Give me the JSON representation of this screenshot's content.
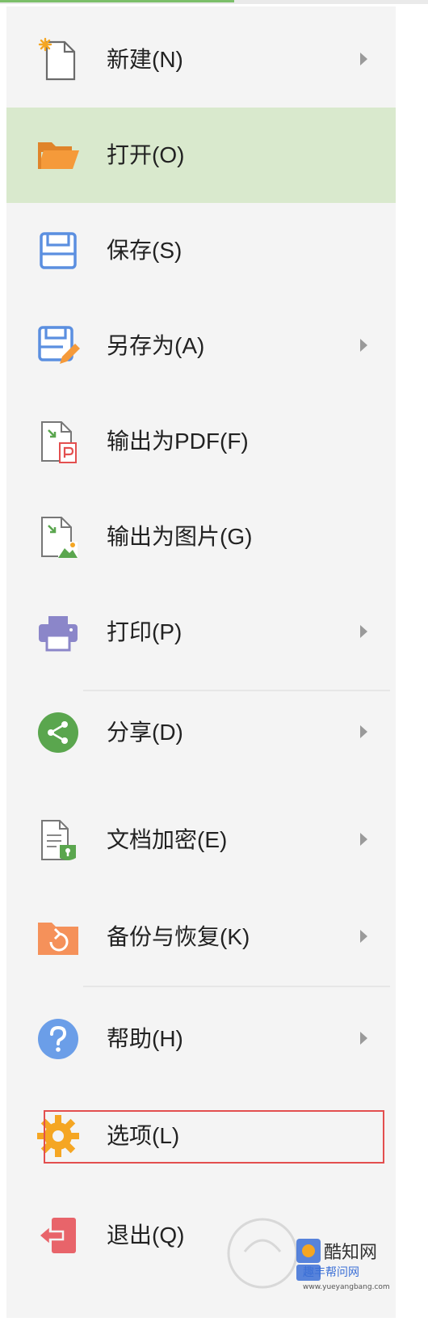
{
  "menu": {
    "items": [
      {
        "label": "新建(N)",
        "icon": "new-document-icon",
        "submenu": true
      },
      {
        "label": "打开(O)",
        "icon": "open-folder-icon",
        "submenu": false,
        "hovered": true
      },
      {
        "label": "保存(S)",
        "icon": "save-icon",
        "submenu": false
      },
      {
        "label": "另存为(A)",
        "icon": "save-as-icon",
        "submenu": true
      },
      {
        "label": "输出为PDF(F)",
        "icon": "export-pdf-icon",
        "submenu": false
      },
      {
        "label": "输出为图片(G)",
        "icon": "export-image-icon",
        "submenu": false
      },
      {
        "label": "打印(P)",
        "icon": "printer-icon",
        "submenu": true
      },
      {
        "label": "分享(D)",
        "icon": "share-icon",
        "submenu": true
      },
      {
        "label": "文档加密(E)",
        "icon": "document-encrypt-icon",
        "submenu": true
      },
      {
        "label": "备份与恢复(K)",
        "icon": "backup-restore-icon",
        "submenu": true
      },
      {
        "label": "帮助(H)",
        "icon": "help-icon",
        "submenu": true
      },
      {
        "label": "选项(L)",
        "icon": "gear-icon",
        "submenu": false,
        "highlighted": true
      },
      {
        "label": "退出(Q)",
        "icon": "exit-icon",
        "submenu": false
      }
    ]
  },
  "colors": {
    "hover_bg": "#d9e9cd",
    "highlight_border": "#e34f4f",
    "folder_orange": "#f59a3a",
    "save_blue": "#5b8fe0",
    "printer_purple": "#8b86c9",
    "share_green": "#5aa64e",
    "help_blue": "#6b9ee8",
    "exit_red": "#e8646a"
  },
  "watermark": {
    "brand": "酷知网",
    "subtitle": "趣丰帮问网",
    "url": "www.yueyangbang.com"
  }
}
